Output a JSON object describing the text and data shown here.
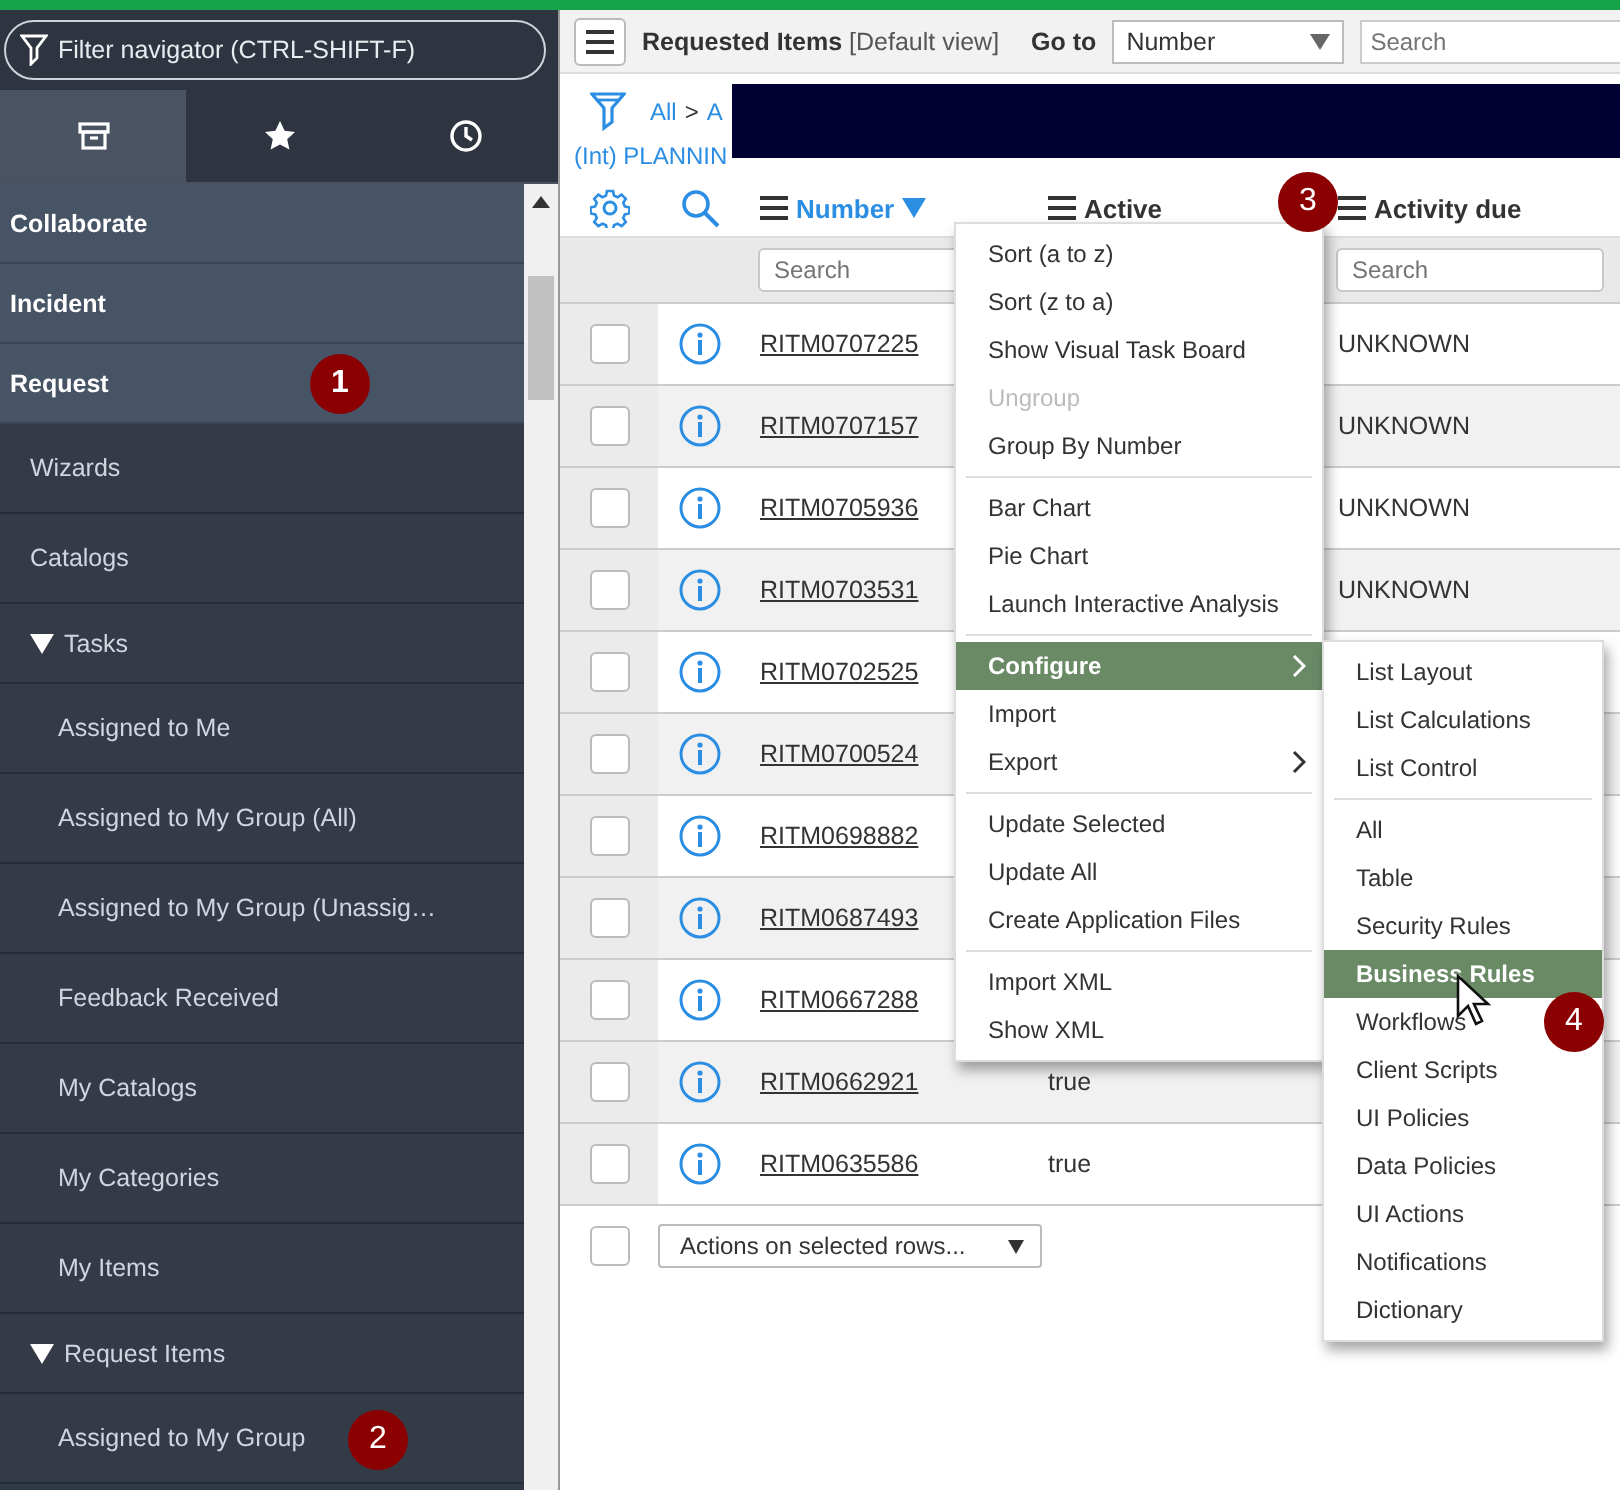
{
  "navigator": {
    "filter_placeholder": "Filter navigator (CTRL-SHIFT-F)",
    "tabs": [
      {
        "kind": "archive",
        "selected": true
      },
      {
        "kind": "star",
        "selected": false
      },
      {
        "kind": "history",
        "selected": false
      }
    ],
    "items": [
      {
        "label": "Collaborate"
      },
      {
        "label": "Incident"
      },
      {
        "label": "Request",
        "callout": "1",
        "children": [
          {
            "label": "Wizards"
          },
          {
            "label": "Catalogs"
          },
          {
            "label": "Tasks",
            "expanded": true,
            "children": [
              {
                "label": "Assigned to Me"
              },
              {
                "label": "Assigned to My Group (All)"
              },
              {
                "label": "Assigned to My Group (Unassig…"
              },
              {
                "label": "Feedback Received"
              },
              {
                "label": "My Catalogs"
              },
              {
                "label": "My Categories"
              },
              {
                "label": "My Items"
              }
            ]
          },
          {
            "label": "Request Items",
            "expanded": true,
            "children": [
              {
                "label": "Assigned to My Group",
                "callout": "2"
              }
            ]
          }
        ]
      }
    ]
  },
  "list_header": {
    "title": "Requested Items",
    "view": "[Default view]",
    "goto_label": "Go to",
    "goto_field": "Number",
    "search_placeholder": "Search"
  },
  "breadcrumb": {
    "root": "All",
    "separator": ">",
    "crumb": "A",
    "condition": "(Int) PLANNIN",
    "redacted": true
  },
  "columns": [
    {
      "label": "Number",
      "sorted": true,
      "descending": true,
      "search_placeholder": "Search"
    },
    {
      "label": "Active",
      "sorted": false
    },
    {
      "label": "Activity due",
      "sorted": false,
      "search_placeholder": "Search",
      "callout": "3"
    }
  ],
  "rows": [
    {
      "number": "RITM0707225",
      "activity_due": "UNKNOWN",
      "checked": false
    },
    {
      "number": "RITM0707157",
      "activity_due": "UNKNOWN",
      "checked": false
    },
    {
      "number": "RITM0705936",
      "activity_due": "UNKNOWN",
      "checked": false
    },
    {
      "number": "RITM0703531",
      "activity_due": "UNKNOWN",
      "checked": false
    },
    {
      "number": "RITM0702525",
      "checked": false
    },
    {
      "number": "RITM0700524",
      "checked": false
    },
    {
      "number": "RITM0698882",
      "checked": false
    },
    {
      "number": "RITM0687493",
      "checked": false
    },
    {
      "number": "RITM0667288",
      "checked": false
    },
    {
      "number": "RITM0662921",
      "active": "true",
      "checked": false
    },
    {
      "number": "RITM0635586",
      "active": "true",
      "checked": false
    }
  ],
  "footer": {
    "select_all_checked": false,
    "actions": "Actions on selected rows..."
  },
  "context_menu": {
    "groups": [
      {
        "items": [
          {
            "label": "Sort (a to z)",
            "disabled": false,
            "selected": false,
            "submenu": false
          },
          {
            "label": "Sort (z to a)",
            "disabled": false,
            "selected": false,
            "submenu": false
          },
          {
            "label": "Show Visual Task Board",
            "disabled": false,
            "selected": false,
            "submenu": false
          },
          {
            "label": "Ungroup",
            "disabled": true,
            "selected": false,
            "submenu": false
          },
          {
            "label": "Group By Number",
            "disabled": false,
            "selected": false,
            "submenu": false
          }
        ]
      },
      {
        "items": [
          {
            "label": "Bar Chart",
            "disabled": false,
            "selected": false,
            "submenu": false
          },
          {
            "label": "Pie Chart",
            "disabled": false,
            "selected": false,
            "submenu": false
          },
          {
            "label": "Launch Interactive Analysis",
            "disabled": false,
            "selected": false,
            "submenu": false
          }
        ]
      },
      {
        "items": [
          {
            "label": "Configure",
            "disabled": false,
            "selected": true,
            "submenu": true
          },
          {
            "label": "Import",
            "disabled": false,
            "selected": false,
            "submenu": false
          },
          {
            "label": "Export",
            "disabled": false,
            "selected": false,
            "submenu": true
          }
        ]
      },
      {
        "items": [
          {
            "label": "Update Selected",
            "disabled": false,
            "selected": false,
            "submenu": false
          },
          {
            "label": "Update All",
            "disabled": false,
            "selected": false,
            "submenu": false
          },
          {
            "label": "Create Application Files",
            "disabled": false,
            "selected": false,
            "submenu": false
          }
        ]
      },
      {
        "items": [
          {
            "label": "Import XML",
            "disabled": false,
            "selected": false,
            "submenu": false
          },
          {
            "label": "Show XML",
            "disabled": false,
            "selected": false,
            "submenu": false
          }
        ]
      }
    ]
  },
  "submenu": {
    "groups": [
      {
        "items": [
          {
            "label": "List Layout",
            "selected": false
          },
          {
            "label": "List Calculations",
            "selected": false
          },
          {
            "label": "List Control",
            "selected": false
          }
        ]
      },
      {
        "items": [
          {
            "label": "All",
            "selected": false
          },
          {
            "label": "Table",
            "selected": false
          },
          {
            "label": "Security Rules",
            "selected": false
          },
          {
            "label": "Business Rules",
            "selected": true,
            "pointer": true
          },
          {
            "label": "Workflows",
            "selected": false,
            "callout": "4"
          },
          {
            "label": "Client Scripts",
            "selected": false
          },
          {
            "label": "UI Policies",
            "selected": false
          },
          {
            "label": "Data Policies",
            "selected": false
          },
          {
            "label": "UI Actions",
            "selected": false
          },
          {
            "label": "Notifications",
            "selected": false
          },
          {
            "label": "Dictionary",
            "selected": false
          }
        ]
      }
    ]
  }
}
